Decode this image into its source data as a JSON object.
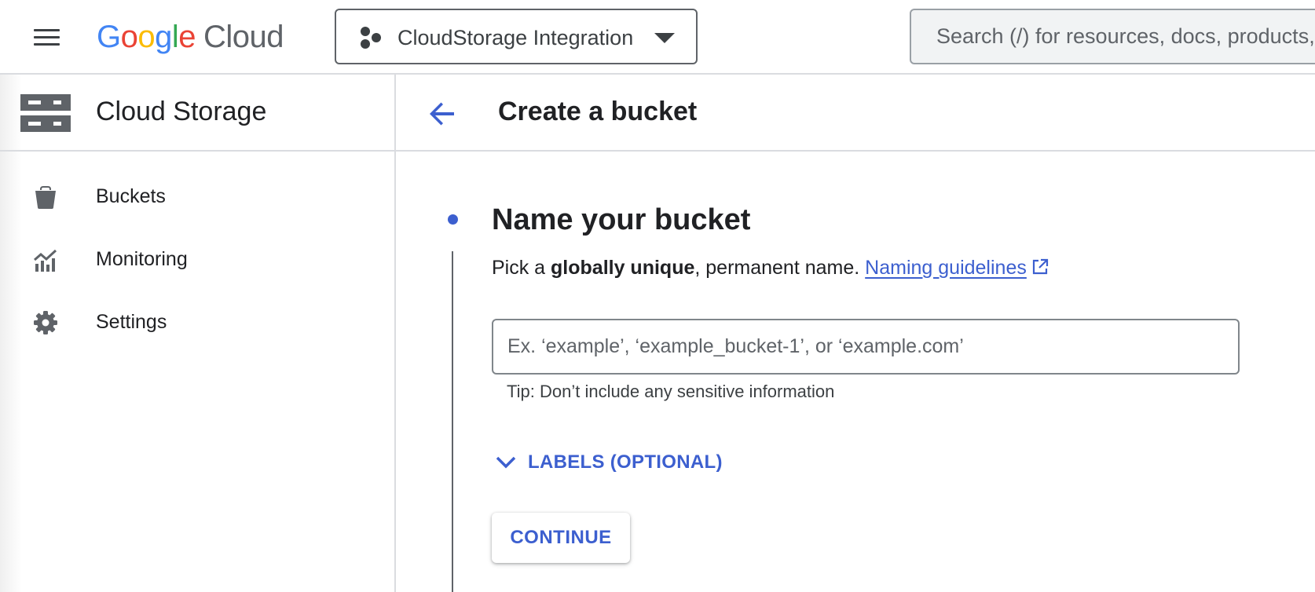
{
  "topbar": {
    "menu_icon": "hamburger-menu-icon",
    "logo": {
      "google_letters": [
        {
          "char": "G",
          "color": "#4285F4"
        },
        {
          "char": "o",
          "color": "#EA4335"
        },
        {
          "char": "o",
          "color": "#FBBC05"
        },
        {
          "char": "g",
          "color": "#4285F4"
        },
        {
          "char": "l",
          "color": "#34A853"
        },
        {
          "char": "e",
          "color": "#EA4335"
        }
      ],
      "cloud_word": "Cloud"
    },
    "project": {
      "name": "CloudStorage Integration",
      "icon": "project-hexagons-icon"
    },
    "search": {
      "placeholder": "Search (/) for resources, docs, products, and more",
      "value": ""
    }
  },
  "sidebar": {
    "title": "Cloud Storage",
    "icon": "cloud-storage-icon",
    "items": [
      {
        "label": "Buckets",
        "icon": "bucket-icon"
      },
      {
        "label": "Monitoring",
        "icon": "monitoring-chart-icon"
      },
      {
        "label": "Settings",
        "icon": "gear-icon"
      }
    ]
  },
  "main": {
    "title": "Create a bucket",
    "step": {
      "title": "Name your bucket",
      "desc_prefix": "Pick a ",
      "desc_bold": "globally unique",
      "desc_suffix": ", permanent name. ",
      "link_text": "Naming guidelines",
      "input_placeholder": "Ex. ‘example’, ‘example_bucket-1’, or ‘example.com’",
      "input_value": "",
      "tip": "Tip: Don’t include any sensitive information",
      "labels_toggle": "LABELS (OPTIONAL)",
      "continue_label": "CONTINUE"
    }
  },
  "colors": {
    "accent_blue": "#3C5FCF",
    "text_primary": "#202124",
    "text_secondary": "#5F6368",
    "divider": "#DADCE0"
  }
}
